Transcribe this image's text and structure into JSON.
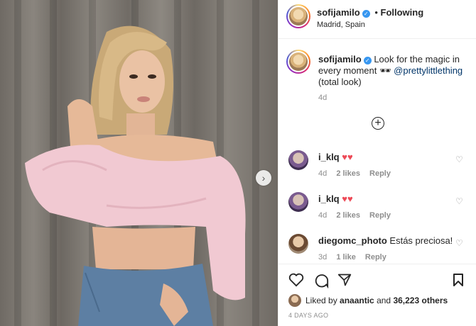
{
  "post": {
    "username": "sofijamilo",
    "follow_separator": "•",
    "follow_label": "Following",
    "location": "Madrid, Spain"
  },
  "caption": {
    "username": "sofijamilo",
    "text_part1": "Look for the magic in every moment",
    "emoji": "🕶",
    "mention": "@prettylittlething",
    "text_part2": "(total look)",
    "time": "4d"
  },
  "load_more_icon": "plus-circle-icon",
  "comments": [
    {
      "username": "i_klq",
      "text": "♥♥",
      "time": "4d",
      "likes": "2 likes",
      "reply": "Reply"
    },
    {
      "username": "i_klq",
      "text": "♥♥",
      "time": "4d",
      "likes": "2 likes",
      "reply": "Reply"
    },
    {
      "username": "diegomc_photo",
      "text": "Estás preciosa!",
      "time": "3d",
      "likes": "1 like",
      "reply": "Reply"
    }
  ],
  "likes": {
    "prefix": "Liked by",
    "user": "anaantic",
    "connector": "and",
    "others": "36,223 others"
  },
  "timestamp": "4 DAYS AGO",
  "colors": {
    "link": "#003569",
    "verified": "#3897f0",
    "heart": "#ed4956"
  }
}
